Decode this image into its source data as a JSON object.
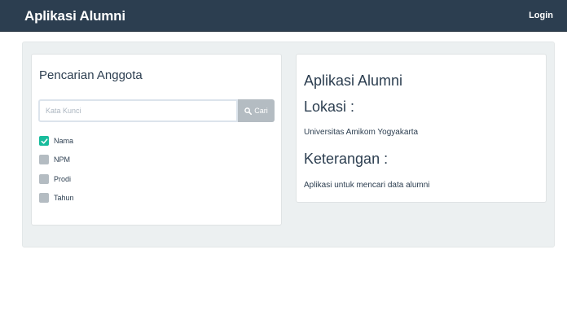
{
  "navbar": {
    "brand": "Aplikasi Alumni",
    "login_label": "Login"
  },
  "search": {
    "title": "Pencarian Anggota",
    "placeholder": "Kata Kunci",
    "button_label": "Cari",
    "button_icon": "search-icon",
    "options": [
      {
        "label": "Nama",
        "checked": true
      },
      {
        "label": "NPM",
        "checked": false
      },
      {
        "label": "Prodi",
        "checked": false
      },
      {
        "label": "Tahun",
        "checked": false
      }
    ]
  },
  "info": {
    "title": "Aplikasi Alumni",
    "location_heading": "Lokasi :",
    "location_text": "Universitas Amikom Yogyakarta",
    "description_heading": "Keterangan :",
    "description_text": "Aplikasi untuk mencari data alumni"
  },
  "colors": {
    "navbar": "#2c3e50",
    "accent": "#18bc9c",
    "well": "#ecf0f1",
    "unchecked": "#b4bcc2"
  }
}
